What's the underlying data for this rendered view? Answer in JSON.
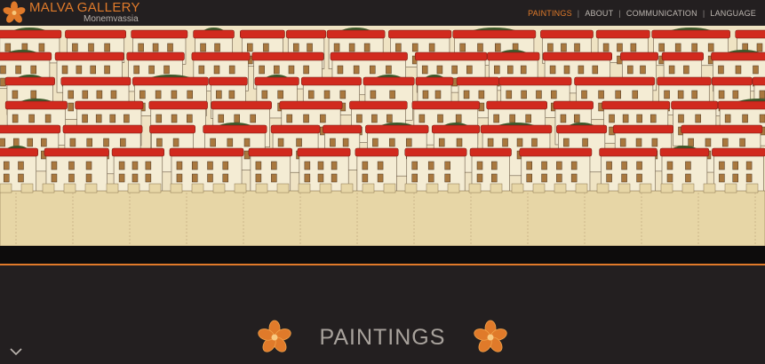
{
  "brand": {
    "name": "MALVA GALLERY",
    "subtitle": "Monemvassia",
    "logo_icon": "malva-flower-icon"
  },
  "nav": {
    "items": [
      {
        "label": "PAINTINGS",
        "active": true
      },
      {
        "label": "ABOUT",
        "active": false
      },
      {
        "label": "COMMUNICATION",
        "active": false
      },
      {
        "label": "LANGUAGE",
        "active": false
      }
    ],
    "separator": "|"
  },
  "hero": {
    "description_icon": "painting-monemvasia-village"
  },
  "section": {
    "title": "PAINTINGS",
    "left_icon": "flower-icon",
    "right_icon": "flower-icon"
  },
  "scroll": {
    "icon": "chevron-down-icon"
  },
  "colors": {
    "accent": "#e07a2a",
    "background": "#231f20",
    "text": "#a8a29c"
  }
}
